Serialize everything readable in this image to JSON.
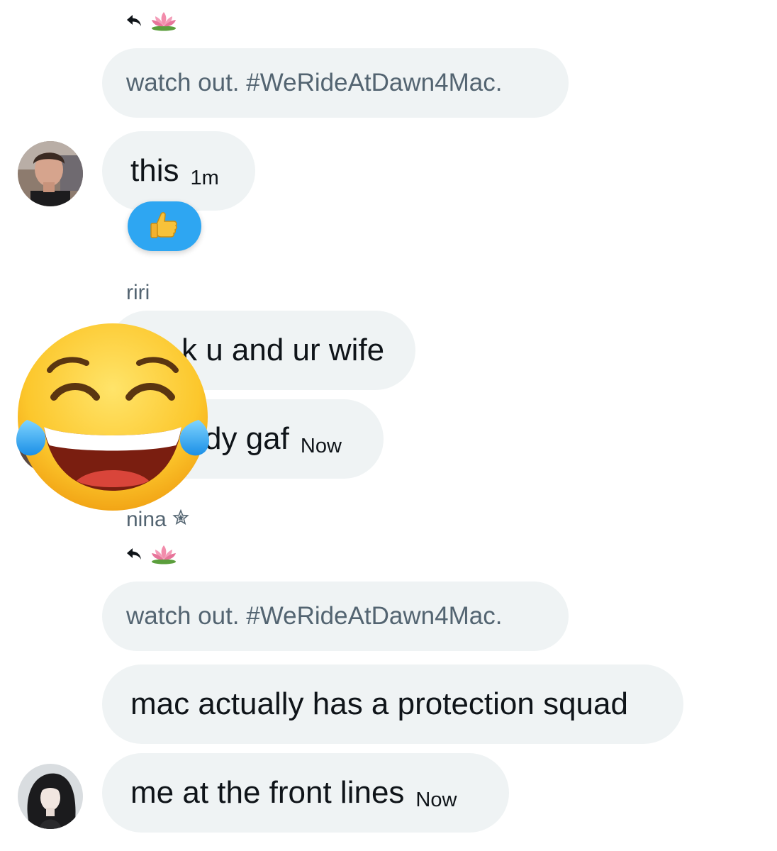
{
  "thread": {
    "block1": {
      "reply_icon": "reply-arrow-icon",
      "reply_emoji": "lotus-icon",
      "quoted_text": "watch out. #WeRideAtDawn4Mac.",
      "message": "this",
      "time": "1m",
      "reaction": "thumbs-up-icon"
    },
    "block2": {
      "sender": "riri",
      "message1_visible": "k u and ur wife",
      "message2_visible": "dy gaf",
      "time": "Now",
      "overlay_emoji": "tears-of-joy-emoji-icon"
    },
    "block3": {
      "sender": "nina",
      "sender_badge": "star-icon",
      "reply_icon": "reply-arrow-icon",
      "reply_emoji": "lotus-icon",
      "quoted_text": "watch out. #WeRideAtDawn4Mac.",
      "message1": "mac actually has a protection squad",
      "message2": "me at the front lines",
      "time": "Now"
    }
  },
  "colors": {
    "bubble_bg": "#eff3f4",
    "secondary_text": "#536471",
    "primary_text": "#0f1419",
    "reaction_bg": "#2ea6f2"
  }
}
